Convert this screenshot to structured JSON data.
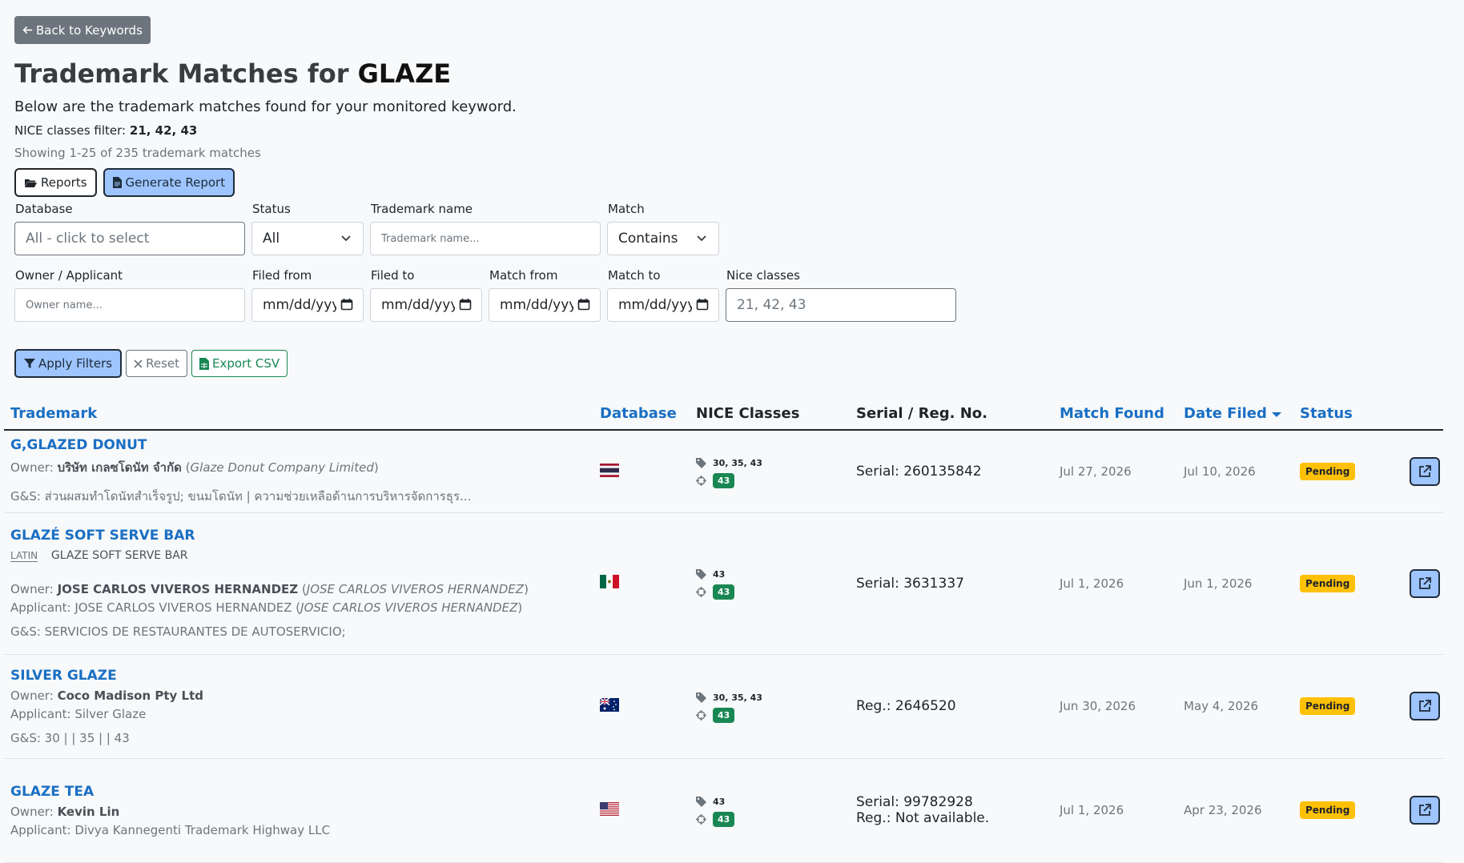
{
  "back_button": {
    "label": "Back to Keywords",
    "icon": "arrow-left-icon"
  },
  "heading": {
    "prefix": "Trademark Matches for",
    "keyword": "GLAZE"
  },
  "lead": "Below are the trademark matches found for your monitored keyword.",
  "nice_filter": {
    "label": "NICE classes filter:",
    "value": "21, 42, 43"
  },
  "showing": "Showing 1-25 of 235 trademark matches",
  "report_buttons": {
    "reports": "Reports",
    "generate": "Generate Report"
  },
  "filters": {
    "database": {
      "label": "Database",
      "value": "All - click to select"
    },
    "status": {
      "label": "Status",
      "value": "All"
    },
    "trademark_name": {
      "label": "Trademark name",
      "placeholder": "Trademark name..."
    },
    "match": {
      "label": "Match",
      "value": "Contains"
    },
    "owner": {
      "label": "Owner / Applicant",
      "placeholder": "Owner name..."
    },
    "filed_from": {
      "label": "Filed from",
      "value": "mm/dd/yyyy"
    },
    "filed_to": {
      "label": "Filed to",
      "value": "mm/dd/yyyy"
    },
    "match_from": {
      "label": "Match from",
      "value": "mm/dd/yyyy"
    },
    "match_to": {
      "label": "Match to",
      "value": "mm/dd/yyyy"
    },
    "nice_classes": {
      "label": "Nice classes",
      "value": "21, 42, 43"
    }
  },
  "actions": {
    "apply": "Apply Filters",
    "reset": "Reset",
    "export": "Export CSV"
  },
  "table": {
    "headers": {
      "trademark": "Trademark",
      "database": "Database",
      "nice": "NICE Classes",
      "serial": "Serial / Reg. No.",
      "match_found": "Match Found",
      "date_filed": "Date Filed",
      "status": "Status"
    },
    "rows": [
      {
        "name": "G,GLAZED DONUT",
        "owner_label": "Owner:",
        "owner": "บริษัท เกลซโดนัท จำกัด",
        "owner_alt": "Glaze Donut Company Limited",
        "gs": "G&S: ส่วนผสมทำโดนัทสำเร็จรูป; ขนมโดนัท | ความช่วยเหลือด้านการบริหารจัดการธุร...",
        "flag": "thailand",
        "nice_tags": "30, 35, 43",
        "nice_match": "43",
        "serial": "Serial: 260135842",
        "match_found": "Jul 27, 2026",
        "date_filed": "Jul 10, 2026",
        "status": "Pending"
      },
      {
        "name": "GLAZÉ SOFT SERVE BAR",
        "latin_label": "LATIN",
        "latin_value": "GLAZE SOFT SERVE BAR",
        "owner_label": "Owner:",
        "owner": "JOSE CARLOS VIVEROS HERNANDEZ",
        "owner_alt": "JOSE CARLOS VIVEROS HERNANDEZ",
        "applicant_label": "Applicant:",
        "applicant": "JOSE CARLOS VIVEROS HERNANDEZ",
        "applicant_alt": "JOSE CARLOS VIVEROS HERNANDEZ",
        "gs": "G&S: SERVICIOS DE RESTAURANTES DE AUTOSERVICIO;",
        "flag": "mexico",
        "nice_tags": "43",
        "nice_match": "43",
        "serial": "Serial: 3631337",
        "match_found": "Jul 1, 2026",
        "date_filed": "Jun 1, 2026",
        "status": "Pending"
      },
      {
        "name": "SILVER GLAZE",
        "owner_label": "Owner:",
        "owner": "Coco Madison Pty Ltd",
        "applicant_label": "Applicant:",
        "applicant": "Silver Glaze",
        "gs": "G&S: 30 | | 35 | | 43",
        "flag": "australia",
        "nice_tags": "30, 35, 43",
        "nice_match": "43",
        "serial": "Reg.: 2646520",
        "match_found": "Jun 30, 2026",
        "date_filed": "May 4, 2026",
        "status": "Pending"
      },
      {
        "name": "GLAZE TEA",
        "owner_label": "Owner:",
        "owner": "Kevin Lin",
        "applicant_label": "Applicant:",
        "applicant": "Divya Kannegenti Trademark Highway LLC",
        "flag": "usa",
        "nice_tags": "43",
        "nice_match": "43",
        "serial": "Serial: 99782928",
        "reg": "Reg.: Not available.",
        "match_found": "Jul 1, 2026",
        "date_filed": "Apr 23, 2026",
        "status": "Pending"
      }
    ]
  },
  "colors": {
    "link": "#1a6fc4",
    "pending": "#ffc107",
    "class_badge": "#198754",
    "primary_soft": "#9ec5fe"
  }
}
